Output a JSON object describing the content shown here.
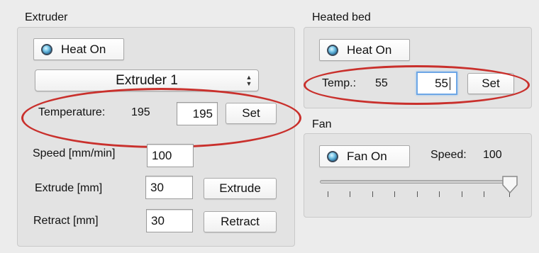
{
  "extruder": {
    "title": "Extruder",
    "heat_button": "Heat On",
    "selector": {
      "value": "Extruder 1"
    },
    "temperature": {
      "label": "Temperature:",
      "current": "195",
      "input": "195",
      "set_label": "Set"
    },
    "speed": {
      "label": "Speed [mm/min]",
      "input": "100"
    },
    "extrude": {
      "label": "Extrude [mm]",
      "input": "30",
      "button": "Extrude"
    },
    "retract": {
      "label": "Retract [mm]",
      "input": "30",
      "button": "Retract"
    }
  },
  "heated_bed": {
    "title": "Heated bed",
    "heat_button": "Heat On",
    "temp": {
      "label": "Temp.:",
      "current": "55",
      "input": "55",
      "set_label": "Set"
    }
  },
  "fan": {
    "title": "Fan",
    "fan_button": "Fan On",
    "speed_label": "Speed:",
    "speed_value": "100",
    "slider_value_percent": 100
  },
  "colors": {
    "highlight": "#c9302c",
    "led": "#5fb6e0"
  }
}
